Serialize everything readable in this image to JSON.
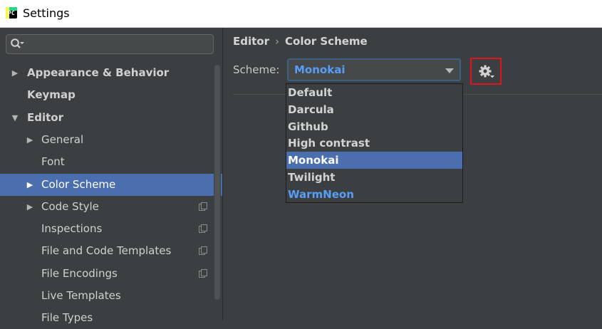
{
  "window": {
    "title": "Settings",
    "app_icon": "pycharm-icon"
  },
  "sidebar": {
    "search": {
      "value": "",
      "placeholder": ""
    },
    "items": [
      {
        "label": "Appearance & Behavior",
        "level": 0,
        "expandable": true,
        "expanded": false,
        "bold": true
      },
      {
        "label": "Keymap",
        "level": 0,
        "expandable": false,
        "bold": true
      },
      {
        "label": "Editor",
        "level": 0,
        "expandable": true,
        "expanded": true,
        "bold": true
      },
      {
        "label": "General",
        "level": 1,
        "expandable": true,
        "expanded": false
      },
      {
        "label": "Font",
        "level": 1,
        "expandable": false
      },
      {
        "label": "Color Scheme",
        "level": 1,
        "expandable": true,
        "expanded": false,
        "selected": true
      },
      {
        "label": "Code Style",
        "level": 1,
        "expandable": true,
        "expanded": false,
        "project_icon": true
      },
      {
        "label": "Inspections",
        "level": 1,
        "expandable": false,
        "project_icon": true
      },
      {
        "label": "File and Code Templates",
        "level": 1,
        "expandable": false,
        "project_icon": true
      },
      {
        "label": "File Encodings",
        "level": 1,
        "expandable": false,
        "project_icon": true
      },
      {
        "label": "Live Templates",
        "level": 1,
        "expandable": false
      },
      {
        "label": "File Types",
        "level": 1,
        "expandable": false
      }
    ]
  },
  "content": {
    "breadcrumb": {
      "part1": "Editor",
      "separator": "›",
      "part2": "Color Scheme"
    },
    "scheme_label": "Scheme:",
    "scheme_value": "Monokai",
    "scheme_options": [
      {
        "label": "Default"
      },
      {
        "label": "Darcula"
      },
      {
        "label": "Github"
      },
      {
        "label": "High contrast"
      },
      {
        "label": "Monokai",
        "selected": true
      },
      {
        "label": "Twilight"
      },
      {
        "label": "WarmNeon",
        "highlight_blue": true
      }
    ],
    "gear_icon": "gear-icon"
  },
  "colors": {
    "background": "#3c3f41",
    "selection": "#4b6eaf",
    "accent_blue": "#589df6",
    "highlight_red": "#e0141c"
  }
}
